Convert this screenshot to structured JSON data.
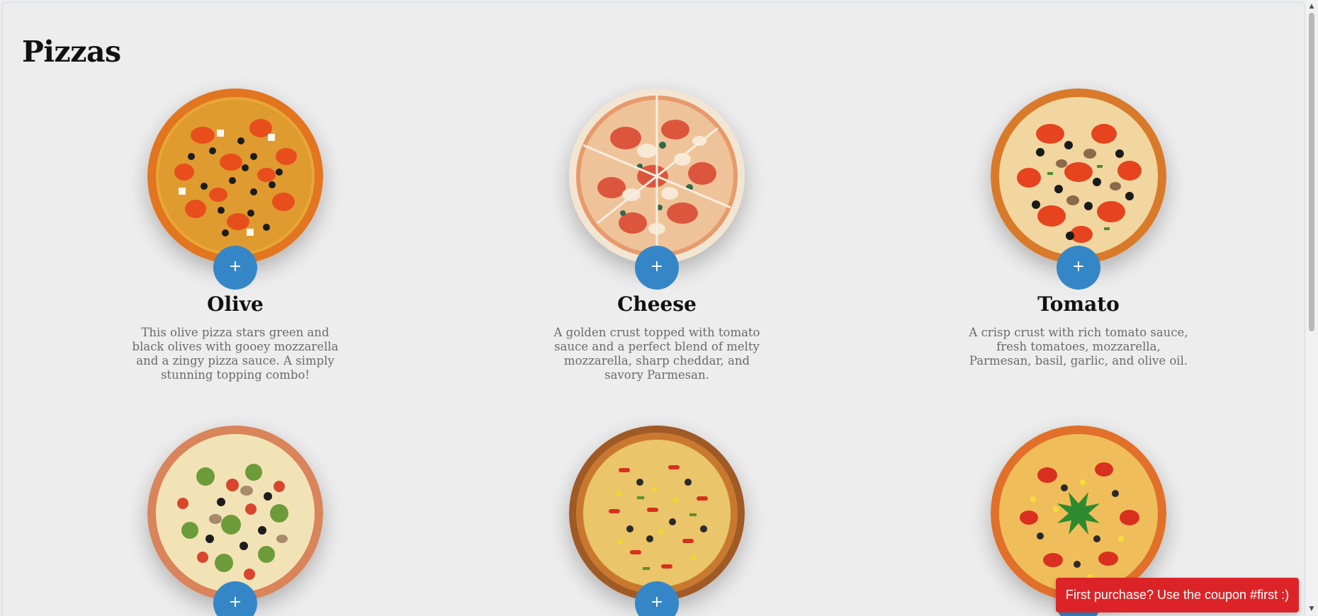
{
  "page": {
    "title": "Pizzas"
  },
  "pizzas": [
    {
      "name": "Olive",
      "description": "This olive pizza stars green and black olives with gooey mozzarella and a zingy pizza sauce. A simply stunning topping combo!",
      "add_label": "+"
    },
    {
      "name": "Cheese",
      "description": "A golden crust topped with tomato sauce and a perfect blend of melty mozzarella, sharp cheddar, and savory Parmesan.",
      "add_label": "+"
    },
    {
      "name": "Tomato",
      "description": "A crisp crust with rich tomato sauce, fresh tomatoes, mozzarella, Parmesan, basil, garlic, and olive oil.",
      "add_label": "+"
    },
    {
      "name": "",
      "description": "",
      "add_label": "+"
    },
    {
      "name": "",
      "description": "",
      "add_label": "+"
    },
    {
      "name": "",
      "description": "",
      "add_label": "+"
    }
  ],
  "toast": {
    "message": "First purchase? Use the coupon #first :)"
  },
  "colors": {
    "background": "#ededed",
    "accent": "#3586c7",
    "toast": "#dc2428"
  },
  "icons": {
    "scroll_up": "▲",
    "scroll_down": "▼"
  }
}
